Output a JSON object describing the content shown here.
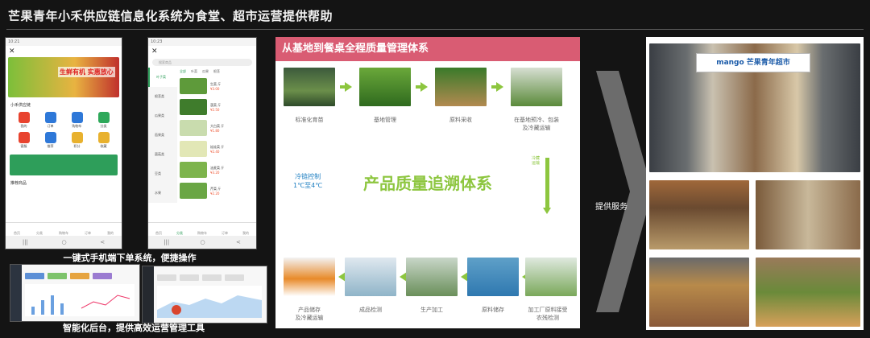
{
  "title": "芒果青年小禾供应链信息化系统为食堂、超市运营提供帮助",
  "phone1": {
    "status": "10:21",
    "close": "✕",
    "banner_text": "生鲜有机 实惠放心",
    "shop": "小禾供应链",
    "icons": [
      "我的",
      "订单",
      "购物车",
      "分类",
      "客服",
      "推荐",
      "积分",
      "收藏"
    ],
    "recommend": "推荐商品",
    "tabs": [
      "首页",
      "分类",
      "购物车",
      "订单",
      "我的"
    ],
    "nav": [
      "|||",
      "○",
      "<"
    ]
  },
  "phone2": {
    "status": "10:23",
    "close": "✕",
    "search": "搜索商品",
    "categories": [
      "叶子菜",
      "根茎类",
      "瓜果类",
      "茄果类",
      "菌菇类",
      "豆类",
      "水果"
    ],
    "ptabs": [
      "全部",
      "叶菜",
      "瓜果",
      "根茎"
    ],
    "products": [
      {
        "name": "生菜 斤",
        "price": "¥3.00"
      },
      {
        "name": "菠菜 斤",
        "price": "¥2.50"
      },
      {
        "name": "大白菜 斤",
        "price": "¥1.80"
      },
      {
        "name": "娃娃菜 斤",
        "price": "¥2.40"
      },
      {
        "name": "油麦菜 斤",
        "price": "¥3.20"
      },
      {
        "name": "芹菜 斤",
        "price": "¥2.20"
      }
    ],
    "tabs": [
      "首页",
      "分类",
      "购物车",
      "订单",
      "我的"
    ],
    "nav": [
      "|||",
      "○",
      "<"
    ]
  },
  "caption1": "一键式手机端下单系统，便捷操作",
  "caption2": "智能化后台，提供高效运营管理工具",
  "panel": {
    "header": "从基地到餐桌全程质量管理体系",
    "top_stages": [
      "标准化育苗",
      "基地管理",
      "原料采收",
      "在基地预冷、包装\n及冷藏运输"
    ],
    "bottom_stages": [
      "产品储存\n及冷藏运输",
      "成品检测",
      "生产加工",
      "原料储存",
      "加工厂原料接受\n农残检测"
    ],
    "center_title": "产品质量追溯体系",
    "cold_chain": "冷链控制\n1℃至4℃",
    "vertical_text": "冷藏运输"
  },
  "service_label": "提供服务",
  "store_sign": "mango 芒果青年超市"
}
